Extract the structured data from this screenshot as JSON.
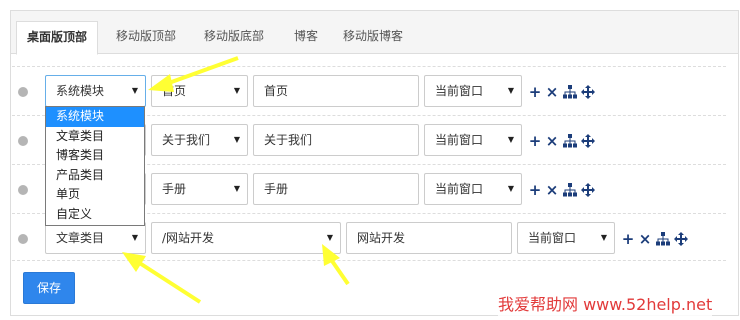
{
  "tabs": [
    {
      "label": "桌面版顶部",
      "active": true
    },
    {
      "label": "移动版顶部",
      "active": false
    },
    {
      "label": "移动版底部",
      "active": false
    },
    {
      "label": "博客",
      "active": false
    },
    {
      "label": "移动版博客",
      "active": false
    }
  ],
  "menu_rows": [
    {
      "type": "系统模块",
      "target": "首页",
      "title": "首页",
      "window": "当前窗口"
    },
    {
      "type": "",
      "target": "关于我们",
      "title": "关于我们",
      "window": "当前窗口"
    },
    {
      "type": "",
      "target": "手册",
      "title": "手册",
      "window": "当前窗口"
    },
    {
      "type": "文章类目",
      "target": "/网站开发",
      "title": "网站开发",
      "window": "当前窗口"
    }
  ],
  "dropdown": {
    "options": [
      "系统模块",
      "文章类目",
      "博客类目",
      "产品类目",
      "单页",
      "自定义"
    ],
    "highlighted": "系统模块"
  },
  "actions": {
    "add_icon": "plus-icon",
    "delete_icon": "times-icon",
    "tree_icon": "sitemap-icon",
    "move_icon": "arrows-move-icon"
  },
  "save_label": "保存",
  "watermark": {
    "text": "我爱帮助网 www.52help.net",
    "color": "#e23a3a"
  },
  "colors": {
    "accent": "#2f86ec",
    "highlight": "#1e90ff",
    "icon": "#1c3d7a",
    "arrow": "#ffff33"
  }
}
